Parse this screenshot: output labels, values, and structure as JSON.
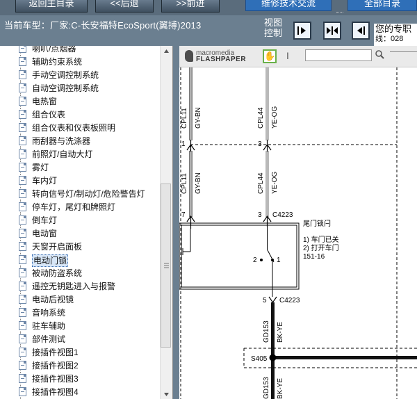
{
  "topbar": {
    "home_label": "返回主目录",
    "back_label": "<<后退",
    "forward_label": ">>前进",
    "tech_exchange_label": "维修技术交流",
    "right_button_label": "全部目录"
  },
  "info": {
    "current_model": "当前车型：厂家:C-长安福特EcoSport(翼搏)2013",
    "view_control_line1": "视图",
    "view_control_line2": "控制",
    "notice_line1": "您的专职",
    "notice_line2": "线：028"
  },
  "tree": {
    "items": [
      "喇叭/点烟器",
      "辅助约束系统",
      "手动空调控制系统",
      "自动空调控制系统",
      "电热窗",
      "组合仪表",
      "组合仪表和仪表板照明",
      "雨刮器与洗涤器",
      "前照灯/自动大灯",
      "雾灯",
      "车内灯",
      "转向信号灯/制动灯/危险警告灯",
      "停车灯，尾灯和牌照灯",
      "倒车灯",
      "电动窗",
      "天窗开启面板",
      "电动门锁",
      "被动防盗系统",
      "遥控无钥匙进入与报警",
      "电动后视镜",
      "音响系统",
      "驻车辅助",
      "部件测试",
      "接插件视图1",
      "接插件视图2",
      "接插件视图3",
      "接插件视图4"
    ],
    "selected_index": 16
  },
  "viewer": {
    "logo_top": "macromedia",
    "logo_bottom": "FLASHPAPER"
  },
  "diagram": {
    "wire1_code": "CPL11",
    "wire1_color": "GY-BN",
    "wire2_code": "CPL44",
    "wire2_color": "YE-OG",
    "pin1": "1",
    "pin3": "3",
    "pin7": "7",
    "pin3b": "3",
    "connector_top": "C4223",
    "component_title": "尾门锁闩",
    "state1": "1) 车门已关",
    "state2": "2) 打开车门",
    "ref": "151-16",
    "sw_pin2": "2",
    "sw_pin1": "1",
    "pin5": "5",
    "connector_bottom": "C4223",
    "wire3_code": "GD153",
    "wire3_color": "BK-YE",
    "splice": "S405",
    "wire4_code": "GD153",
    "wire4_color": "BK-YE"
  }
}
